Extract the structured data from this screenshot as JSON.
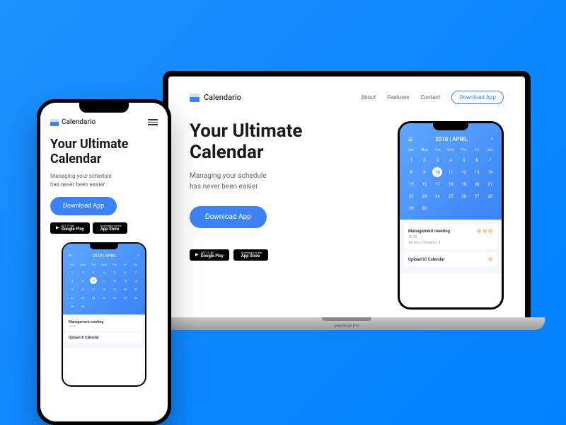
{
  "brand": "Calendario",
  "nav": {
    "about": "About",
    "features": "Features",
    "contact": "Contact",
    "download": "Download App"
  },
  "hero": {
    "headline_l1": "Your Ultimate",
    "headline_l2": "Calendar",
    "sub_l1": "Managing your schedule",
    "sub_l2": "has never been easier",
    "cta": "Download App"
  },
  "stores": {
    "google_top": "GET IT ON",
    "google": "Google Play",
    "apple_top": "Download on the",
    "apple": "App Store"
  },
  "calendar": {
    "title": "2018 | APRIL",
    "days": [
      "Sun",
      "Mon",
      "Tue",
      "Wed",
      "Thu",
      "Fri",
      "Sat"
    ],
    "dates": [
      1,
      2,
      3,
      4,
      5,
      6,
      7,
      8,
      9,
      10,
      11,
      12,
      13,
      14,
      15,
      16,
      17,
      18,
      19,
      20,
      21,
      22,
      23,
      24,
      25,
      26,
      27,
      28,
      29,
      30
    ],
    "selected": 10
  },
  "events": [
    {
      "title": "Management meeting",
      "time": "10:30",
      "loc": "Tel Aviv, Ein Ganim 8"
    },
    {
      "title": "Upload UI Calendar",
      "time": "",
      "loc": ""
    }
  ],
  "laptop_brand": "MacBook Pro"
}
